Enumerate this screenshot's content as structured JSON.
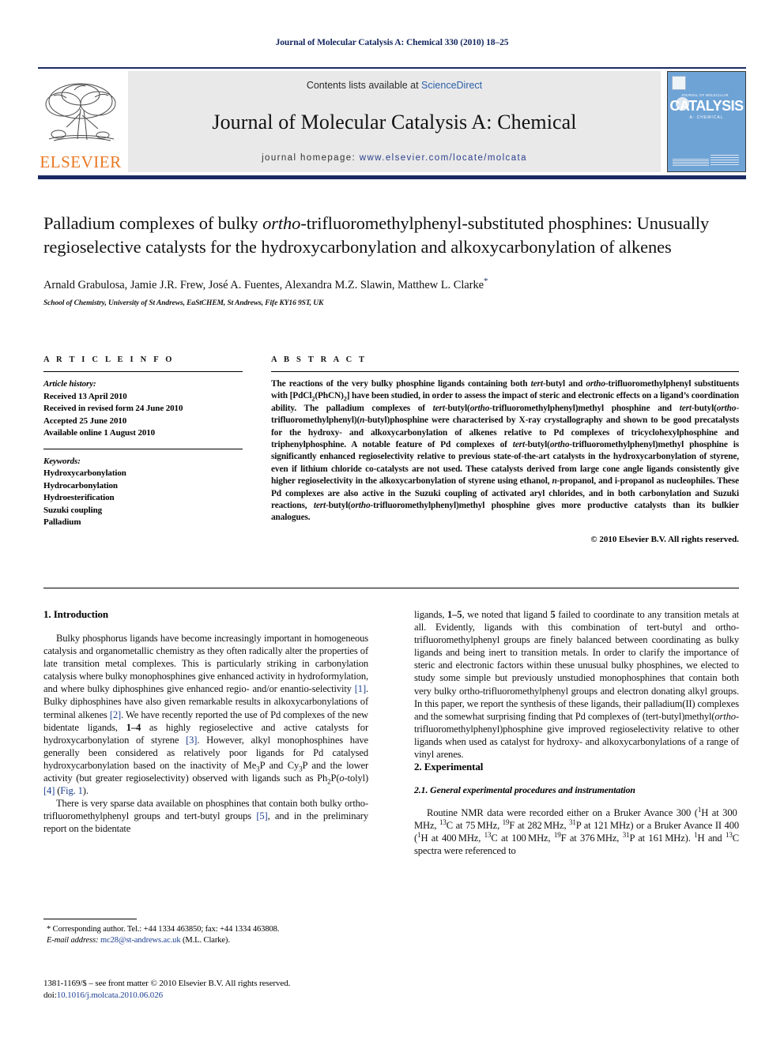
{
  "running_head": "Journal of Molecular Catalysis A: Chemical 330 (2010) 18–25",
  "masthead": {
    "contents_prefix": "Contents lists available at ",
    "sciencedirect": "ScienceDirect",
    "journal_title": "Journal of Molecular Catalysis A: Chemical",
    "homepage_prefix": "journal homepage: ",
    "homepage_url": "www.elsevier.com/locate/molcata",
    "publisher": "ELSEVIER",
    "cover": {
      "kicker": "JOURNAL OF MOLECULAR",
      "main": "CATALYSIS",
      "sub": "A: CHEMICAL"
    },
    "accent_navy": "#1b2a63",
    "accent_orange": "#e87722",
    "link_blue": "#2b5fa8"
  },
  "article": {
    "title": "Palladium complexes of bulky ortho-trifluoromethylphenyl-substituted phosphines: Unusually regioselective catalysts for the hydroxycarbonylation and alkoxycarbonylation of alkenes",
    "authors": "Arnald Grabulosa, Jamie J.R. Frew, José A. Fuentes, Alexandra M.Z. Slawin, Matthew L. Clarke",
    "corresponding_marker": "*",
    "affiliation": "School of Chemistry, University of St Andrews, EaStCHEM, St Andrews, Fife KY16 9ST, UK"
  },
  "article_info": {
    "heading": "A R T I C L E    I N F O",
    "history_label": "Article history:",
    "history": [
      "Received 13 April 2010",
      "Received in revised form 24 June 2010",
      "Accepted 25 June 2010",
      "Available online 1 August 2010"
    ],
    "keywords_label": "Keywords:",
    "keywords": [
      "Hydroxycarbonylation",
      "Hydrocarbonylation",
      "Hydroesterification",
      "Suzuki coupling",
      "Palladium"
    ]
  },
  "abstract": {
    "heading": "A B S T R A C T",
    "copyright": "© 2010 Elsevier B.V. All rights reserved."
  },
  "sections": {
    "intro_heading": "1.  Introduction",
    "experimental_heading": "2.  Experimental",
    "experimental_sub": "2.1.   General experimental procedures and instrumentation"
  },
  "footnote": {
    "corresponding": "* Corresponding author. Tel.: +44 1334 463850; fax: +44 1334 463808.",
    "email_label": "E-mail address:",
    "email": "mc28@st-andrews.ac.uk",
    "email_owner": "(M.L. Clarke).",
    "issn_line": "1381-1169/$ – see front matter © 2010 Elsevier B.V. All rights reserved.",
    "doi_label": "doi:",
    "doi": "10.1016/j.molcata.2010.06.026"
  }
}
